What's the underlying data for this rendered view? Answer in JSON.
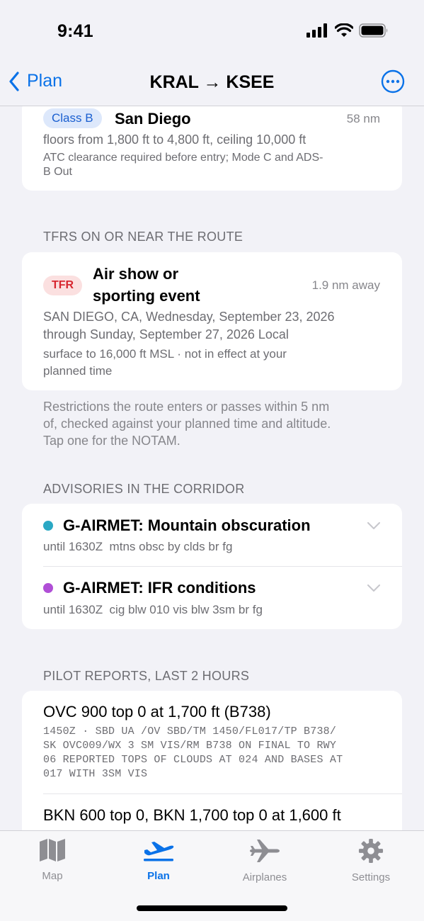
{
  "status": {
    "time": "9:41"
  },
  "nav": {
    "back_label": "Plan",
    "title": "KRAL → KSEE"
  },
  "airspace": {
    "badge": "Class B",
    "name": "San Diego",
    "distance": "58 nm",
    "floors": "floors from 1,800 ft to 4,800 ft, ceiling 10,000 ft",
    "note_line1": "ATC clearance required before entry; Mode C and ADS-",
    "note_line2": "B Out"
  },
  "tfrs": {
    "header": "TFRS ON OR NEAR THE ROUTE",
    "badge": "TFR",
    "title_line1": "Air show or",
    "title_line2": "sporting event",
    "distance": "1.9 nm away",
    "location_line1": "SAN DIEGO, CA, Wednesday, September 23, 2026",
    "location_line2": "through Sunday, September 27, 2026 Local",
    "altitude_line1": "surface to 16,000 ft MSL · not in effect at your",
    "altitude_line2": "planned time",
    "footnote_line1": "Restrictions the route enters or passes within 5 nm",
    "footnote_line2": "of, checked against your planned time and altitude.",
    "footnote_line3": "Tap one for the NOTAM."
  },
  "advisories": {
    "header": "ADVISORIES IN THE CORRIDOR",
    "items": [
      {
        "title": "G-AIRMET: Mountain obscuration",
        "detail": "until 1630Z  mtns obsc by clds br fg",
        "color": "#2aa8c4"
      },
      {
        "title": "G-AIRMET: IFR conditions",
        "detail": "until 1630Z  cig blw 010 vis blw 3sm br fg",
        "color": "#b04fd6"
      }
    ]
  },
  "pireps": {
    "header": "PILOT REPORTS, LAST 2 HOURS",
    "items": [
      {
        "title": "OVC 900 top 0 at 1,700 ft (B738)",
        "raw_line1": "1450Z · SBD UA /OV SBD/TM 1450/FL017/TP B738/",
        "raw_line2": "SK OVC009/WX 3 SM VIS/RM B738 ON FINAL TO RWY",
        "raw_line3": "06 REPORTED TOPS OF CLOUDS AT 024 AND BASES AT",
        "raw_line4": "017 WITH 3SM VIS"
      },
      {
        "title": "BKN 600 top 0, BKN 1,700 top 0 at 1,600 ft"
      }
    ]
  },
  "tabs": [
    {
      "label": "Map",
      "icon": "map-icon"
    },
    {
      "label": "Plan",
      "icon": "plane-departure-icon",
      "active": true
    },
    {
      "label": "Airplanes",
      "icon": "airplane-icon"
    },
    {
      "label": "Settings",
      "icon": "gear-icon"
    }
  ],
  "colors": {
    "accent": "#0a72e8",
    "tfr_red": "#d7262f",
    "class_b_blue": "#1a5fd0"
  }
}
